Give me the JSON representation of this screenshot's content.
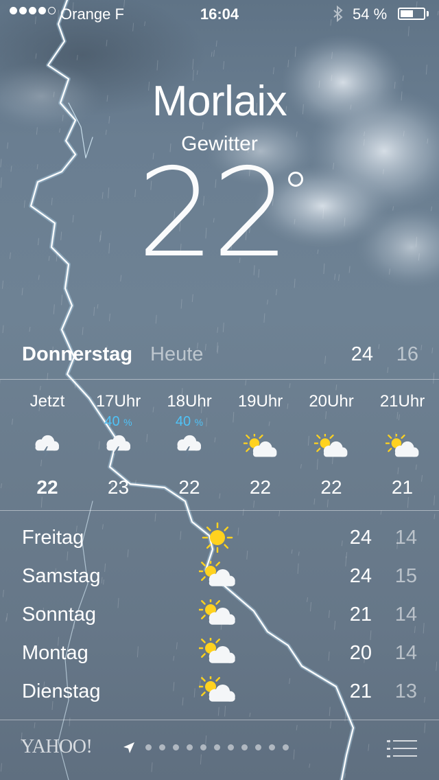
{
  "status_bar": {
    "carrier": "Orange F",
    "time": "16:04",
    "battery_percent": "54 %",
    "battery_level": 0.54,
    "signal_bars": 4,
    "icons": [
      "signal-dots",
      "bluetooth-icon",
      "battery-icon"
    ]
  },
  "weather": {
    "city": "Morlaix",
    "condition": "Gewitter",
    "temperature": "22"
  },
  "today": {
    "day": "Donnerstag",
    "label": "Heute",
    "high": "24",
    "low": "16"
  },
  "hourly": [
    {
      "time": "Jetzt",
      "precip": "",
      "icon": "thunderstorm-icon",
      "temp": "22"
    },
    {
      "time": "17Uhr",
      "precip": "40",
      "icon": "thunderstorm-icon",
      "temp": "23"
    },
    {
      "time": "18Uhr",
      "precip": "40",
      "icon": "thunderstorm-icon",
      "temp": "22"
    },
    {
      "time": "19Uhr",
      "precip": "",
      "icon": "partly-sunny-icon",
      "temp": "22"
    },
    {
      "time": "20Uhr",
      "precip": "",
      "icon": "partly-sunny-icon",
      "temp": "22"
    },
    {
      "time": "21Uhr",
      "precip": "",
      "icon": "partly-sunny-icon",
      "temp": "21"
    }
  ],
  "precip_unit": "%",
  "daily": [
    {
      "day": "Freitag",
      "icon": "sun-icon",
      "high": "24",
      "low": "14"
    },
    {
      "day": "Samstag",
      "icon": "partly-sunny-icon",
      "high": "24",
      "low": "15"
    },
    {
      "day": "Sonntag",
      "icon": "partly-sunny-icon",
      "high": "21",
      "low": "14"
    },
    {
      "day": "Montag",
      "icon": "partly-sunny-icon",
      "high": "20",
      "low": "14"
    },
    {
      "day": "Dienstag",
      "icon": "partly-sunny-icon",
      "high": "21",
      "low": "13"
    }
  ],
  "footer": {
    "brand": "YAHOO!",
    "page_count": 11,
    "icons": [
      "location-arrow-icon",
      "list-icon"
    ]
  },
  "colors": {
    "precip": "#4fc3f7",
    "sun": "#ffd21f",
    "background": "#6a7e91"
  }
}
